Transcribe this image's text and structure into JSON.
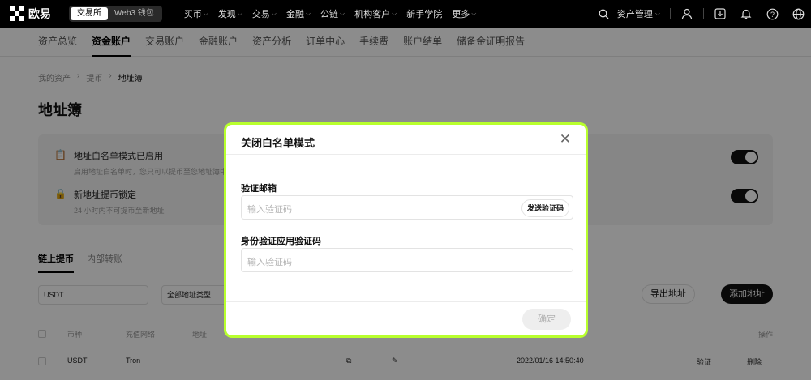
{
  "topnav": {
    "brand": "欧易",
    "switch": [
      "交易所",
      "Web3 钱包"
    ],
    "items": [
      "买币",
      "发现",
      "交易",
      "金融",
      "公链",
      "机构客户",
      "新手学院",
      "更多"
    ],
    "asset_manage": "资产管理"
  },
  "subnav": [
    "资产总览",
    "资金账户",
    "交易账户",
    "金融账户",
    "资产分析",
    "订单中心",
    "手续费",
    "账户结单",
    "储备金证明报告"
  ],
  "breadcrumb": [
    "我的资产",
    "提币",
    "地址簿"
  ],
  "page_title": "地址簿",
  "settings": [
    {
      "title": "地址白名单模式已启用",
      "desc": "启用地址白名单时，您只可以提币至您地址簿中"
    },
    {
      "title": "新地址提币锁定",
      "desc": "24 小时内不可提币至新地址"
    }
  ],
  "tabs": [
    "链上提币",
    "内部转账"
  ],
  "filters": {
    "coin": "USDT",
    "type": "全部地址类型"
  },
  "buttons": {
    "export": "导出地址",
    "add": "添加地址"
  },
  "table": {
    "headers": [
      "币种",
      "充值网络",
      "地址",
      "操作"
    ],
    "row": {
      "coin": "USDT",
      "network": "Tron",
      "time": "2022/01/16 14:50:40",
      "verify": "验证",
      "delete": "删除"
    }
  },
  "modal": {
    "title": "关闭白名单模式",
    "email_label": "验证邮箱",
    "email_placeholder": "输入验证码",
    "send_code": "发送验证码",
    "auth_label": "身份验证应用验证码",
    "auth_placeholder": "输入验证码",
    "confirm": "确定"
  },
  "colors": {
    "accent_border": "#b8ff2d"
  }
}
